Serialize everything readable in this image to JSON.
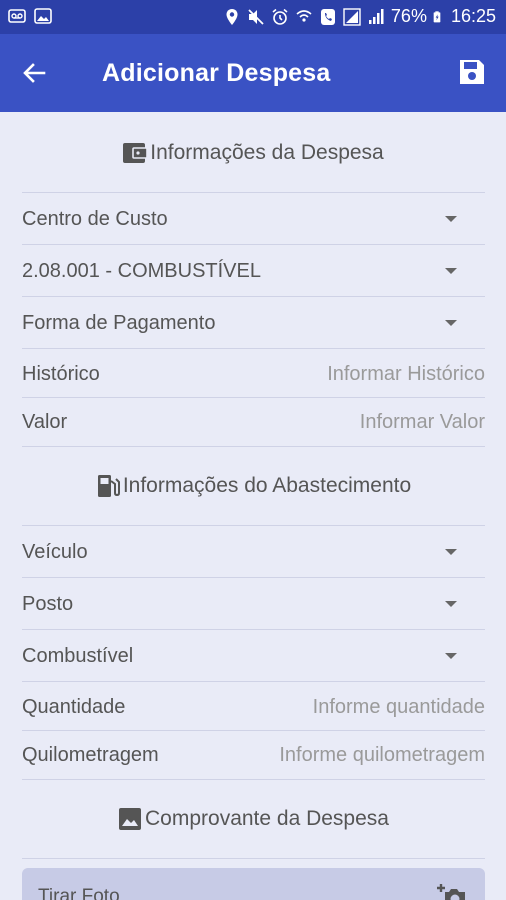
{
  "status_bar": {
    "battery": "76%",
    "time": "16:25"
  },
  "app_bar": {
    "title": "Adicionar Despesa"
  },
  "sections": {
    "despesa_title": "Informações da Despesa",
    "abastecimento_title": "Informações do Abastecimento",
    "comprovante_title": "Comprovante da Despesa"
  },
  "despesa_fields": {
    "centro_custo": "Centro de Custo",
    "conta": "2.08.001 - COMBUSTÍVEL",
    "forma_pagamento": "Forma de Pagamento",
    "historico_label": "Histórico",
    "historico_placeholder": "Informar Histórico",
    "valor_label": "Valor",
    "valor_placeholder": "Informar Valor"
  },
  "abastecimento_fields": {
    "veiculo": "Veículo",
    "posto": "Posto",
    "combustivel": "Combustível",
    "quantidade_label": "Quantidade",
    "quantidade_placeholder": "Informe quantidade",
    "quilometragem_label": "Quilometragem",
    "quilometragem_placeholder": "Informe quilometragem"
  },
  "photo_button": {
    "label": "Tirar Foto"
  }
}
